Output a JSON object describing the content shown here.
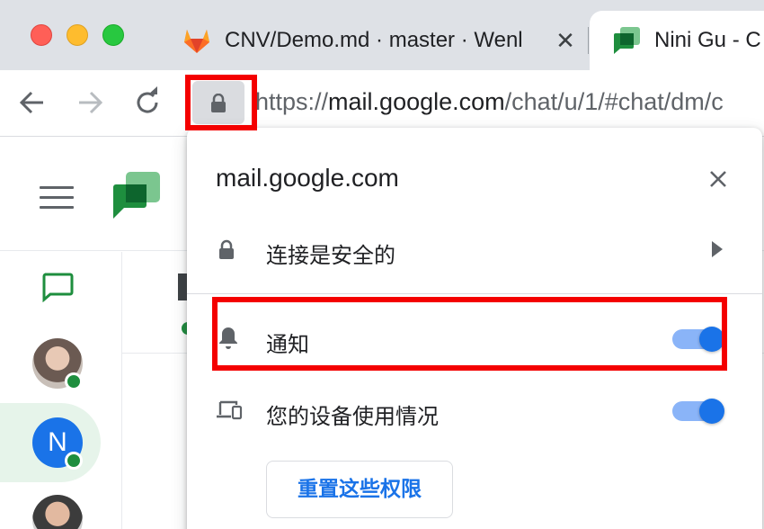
{
  "browser": {
    "tabs": [
      {
        "title": "CNV/Demo.md · master · Wenl",
        "favicon": "gitlab-icon",
        "active": false
      },
      {
        "title": "Nini Gu - C",
        "favicon": "google-chat-icon",
        "active": true
      }
    ],
    "url": {
      "scheme": "https://",
      "host": "mail.google.com",
      "path": "/chat/u/1/#chat/dm/c"
    }
  },
  "app": {
    "rail_avatars": [
      {
        "initial": ""
      },
      {
        "initial": "N"
      },
      {
        "initial": ""
      }
    ]
  },
  "site_info": {
    "domain": "mail.google.com",
    "connection_label": "连接是安全的",
    "permissions": [
      {
        "label": "通知",
        "icon": "bell-icon",
        "enabled": true
      },
      {
        "label": "您的设备使用情况",
        "icon": "devices-icon",
        "enabled": true
      }
    ],
    "reset_button": "重置这些权限"
  },
  "colors": {
    "accent": "#1a73e8",
    "annotation": "#f40000",
    "chat_green": "#1e8e3e"
  }
}
